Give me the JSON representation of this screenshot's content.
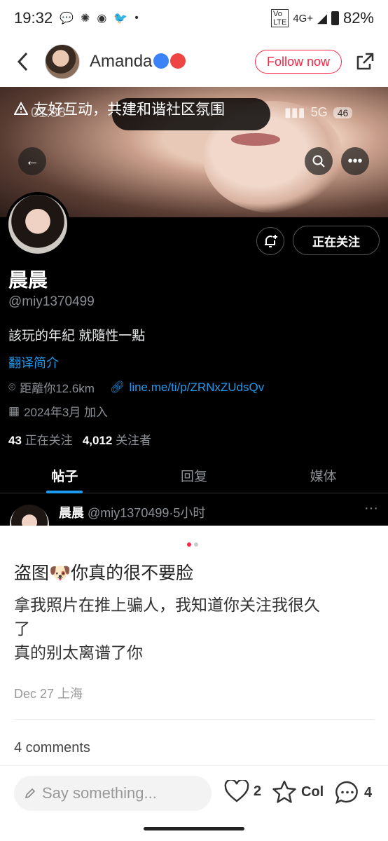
{
  "status_bar": {
    "time": "19:32",
    "network": "4G+",
    "battery": "82%",
    "icons": [
      "chat-bubble-icon",
      "pinwheel-icon",
      "camera-icon",
      "bird-icon",
      "dot-icon"
    ]
  },
  "header": {
    "username": "Amanda",
    "dot_colors": [
      "#3b82f6",
      "#ef4444"
    ],
    "follow_label": "Follow now"
  },
  "screenshot": {
    "warning": "友好互动，共建和谐社区氛围",
    "ghost_time": "01:38",
    "ghost_network": "5G",
    "ghost_battery": "46",
    "following_label": "正在关注",
    "profile_name": "晨晨",
    "handle": "@miy1370499",
    "bio": "該玩的年紀 就隨性一點",
    "translate": "翻译简介",
    "distance": "距離你12.6km",
    "link": "line.me/ti/p/ZRNxZUdsQv",
    "joined": "2024年3月 加入",
    "following_count": "43",
    "following_text": "正在关注",
    "followers_count": "4,012",
    "followers_text": "关注者",
    "tabs": [
      "帖子",
      "回复",
      "媒体"
    ],
    "tweet_name": "晨晨",
    "tweet_meta": "@miy1370499·5小时"
  },
  "post": {
    "title": "盗图🐶你真的很不要脸",
    "body": "拿我照片在推上骗人，我知道你关注我很久\n了\n真的别太离谱了你",
    "date": "Dec 27 上海",
    "comments": "4 comments"
  },
  "bottom": {
    "placeholder": "Say something...",
    "likes": "2",
    "collect": "Col",
    "comment_count": "4"
  },
  "colors": {
    "accent": "#ff2442",
    "x_blue": "#1d9bf0"
  }
}
